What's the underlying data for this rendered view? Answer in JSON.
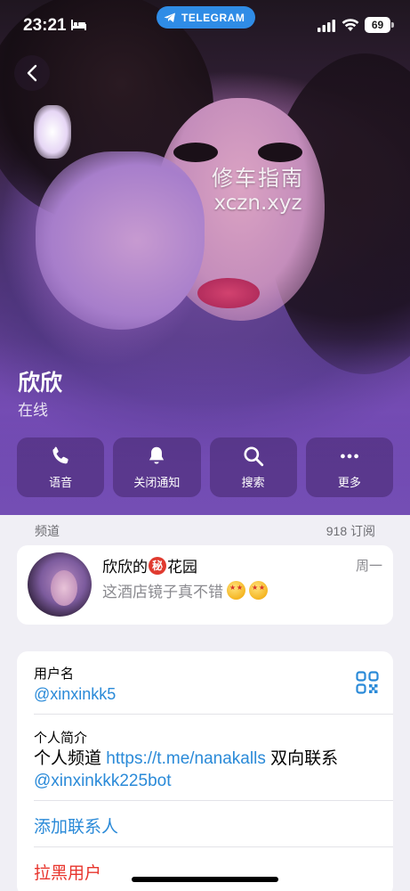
{
  "status_bar": {
    "time": "23:21",
    "telegram_label": "TELEGRAM",
    "battery": "69"
  },
  "hero": {
    "watermark_cn": "修车指南",
    "watermark_en": "xczn.xyz",
    "name": "欣欣",
    "status": "在线"
  },
  "actions": [
    {
      "label": "语音",
      "icon": "phone-icon"
    },
    {
      "label": "关闭通知",
      "icon": "bell-icon"
    },
    {
      "label": "搜索",
      "icon": "search-icon"
    },
    {
      "label": "更多",
      "icon": "more-icon"
    }
  ],
  "channel_section": {
    "title": "频道",
    "count": "918 订阅"
  },
  "channel": {
    "name_prefix": "欣欣的",
    "badge": "秘",
    "name_suffix": "花园",
    "message": "这酒店镜子真不错",
    "time": "周一"
  },
  "info": {
    "username_label": "用户名",
    "username": "@xinxinkk5",
    "bio_label": "个人简介",
    "bio_text_1": "个人频道 ",
    "bio_link": "https://t.me/nanakalls",
    "bio_text_2": " 双向联系",
    "bio_bot": "@xinxinkkk225bot",
    "add_contact": "添加联系人",
    "block_user": "拉黑用户"
  },
  "colors": {
    "accent": "#2a8ad8",
    "danger": "#e8352d",
    "telegram_pill": "#2f8ce6"
  }
}
